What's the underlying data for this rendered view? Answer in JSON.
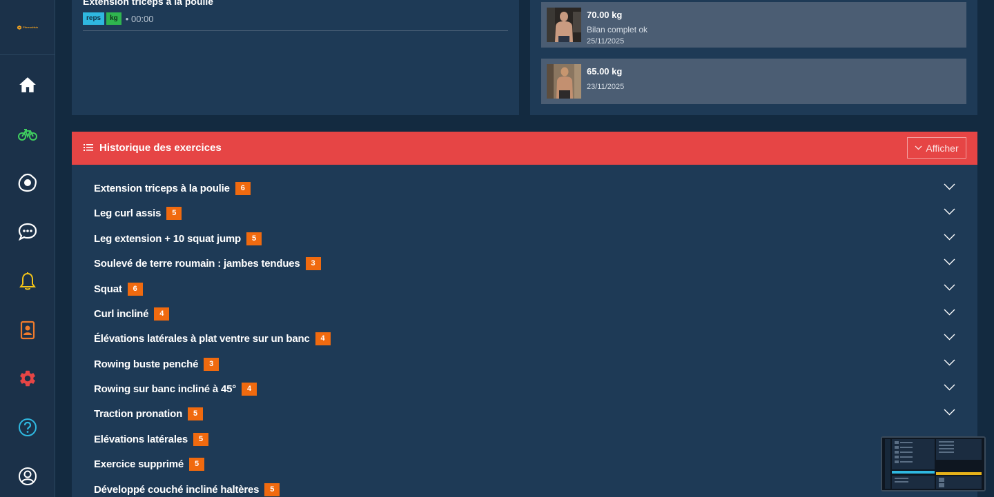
{
  "sidebar": {
    "logo_text": "FitnessHub",
    "items": [
      {
        "icon": "home-icon",
        "color": "#ffffff"
      },
      {
        "icon": "bike-icon",
        "color": "#3fcf5f"
      },
      {
        "icon": "fried-egg-icon",
        "color": "#ffffff"
      },
      {
        "icon": "chat-icon",
        "color": "#ffffff"
      },
      {
        "icon": "bell-icon",
        "color": "#f5c518"
      },
      {
        "icon": "contact-card-icon",
        "color": "#f07b2c"
      },
      {
        "icon": "gear-icon",
        "color": "#e64545"
      },
      {
        "icon": "help-icon",
        "color": "#2fb8e0"
      },
      {
        "icon": "user-icon",
        "color": "#ffffff"
      }
    ]
  },
  "last_exercise": {
    "title": "Extension triceps à la poulie",
    "tag_reps": "reps",
    "tag_kg": "kg",
    "time": "• 00:00"
  },
  "weigh_ins": [
    {
      "weight": "70.00 kg",
      "note": "Bilan complet ok",
      "date": "25/11/2025"
    },
    {
      "weight": "65.00 kg",
      "note": "",
      "date": "23/11/2025"
    }
  ],
  "history": {
    "title": "Historique des exercices",
    "show_button": "Afficher",
    "exercises": [
      {
        "name": "Extension triceps à la poulie",
        "count": "6"
      },
      {
        "name": "Leg curl assis",
        "count": "5"
      },
      {
        "name": "Leg extension + 10 squat jump",
        "count": "5"
      },
      {
        "name": "Soulevé de terre roumain : jambes tendues",
        "count": "3"
      },
      {
        "name": "Squat",
        "count": "6"
      },
      {
        "name": "Curl incliné",
        "count": "4"
      },
      {
        "name": "Élévations latérales à plat ventre sur un banc",
        "count": "4"
      },
      {
        "name": "Rowing buste penché",
        "count": "3"
      },
      {
        "name": "Rowing sur banc incliné à 45°",
        "count": "4"
      },
      {
        "name": "Traction pronation",
        "count": "5"
      },
      {
        "name": "Elévations latérales",
        "count": "5"
      },
      {
        "name": "Exercice supprimé",
        "count": "5"
      },
      {
        "name": "Développé couché incliné haltères",
        "count": "5"
      }
    ]
  },
  "colors": {
    "accent_red": "#e64545",
    "badge_orange": "#f06a0f",
    "panel": "#1e3a56"
  }
}
